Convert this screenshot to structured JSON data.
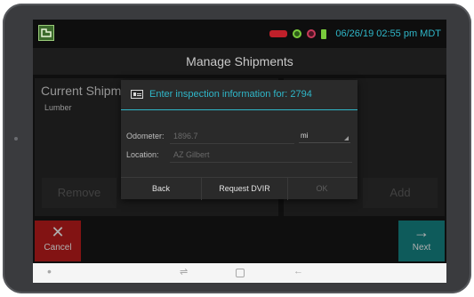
{
  "status": {
    "datetime": "06/26/19 02:55 pm MDT",
    "icons": [
      "app-logo-icon",
      "truck-status-icon",
      "gps-icon",
      "satellite-icon",
      "power-plug-icon"
    ]
  },
  "screen": {
    "title": "Manage Shipments",
    "left_panel": {
      "title": "Current Shipme",
      "items": [
        "Lumber"
      ],
      "remove_label": "Remove"
    },
    "right_panel": {
      "title": "ts",
      "add_label": "Add"
    },
    "cancel_label": "Cancel",
    "next_label": "Next"
  },
  "dialog": {
    "title": "Enter inspection information for: 2794",
    "odometer_label": "Odometer:",
    "odometer_value": "1896.7",
    "unit": "mi",
    "location_label": "Location:",
    "location_value": "AZ Gilbert",
    "back_label": "Back",
    "request_label": "Request DVIR",
    "ok_label": "OK"
  },
  "colors": {
    "accent": "#2fb6c8",
    "cancel": "#b41b1b",
    "next": "#147e7e",
    "truck_status": "#c0202a"
  }
}
